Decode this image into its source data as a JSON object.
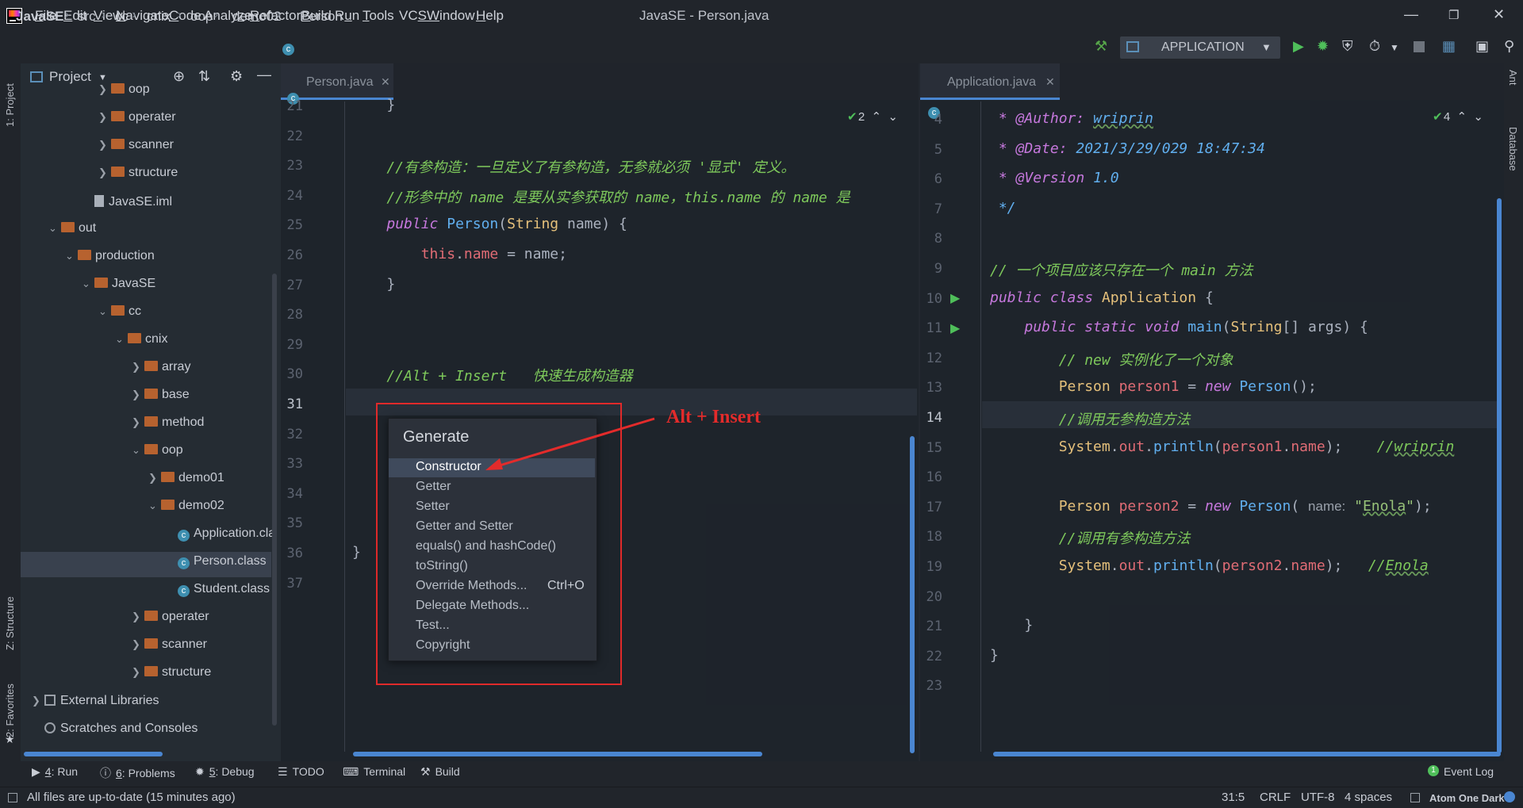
{
  "menubar": {
    "items": [
      "File",
      "Edit",
      "View",
      "Navigate",
      "Code",
      "Analyze",
      "Refactor",
      "Build",
      "Run",
      "Tools",
      "VCS",
      "Window",
      "Help"
    ],
    "mnemonics": [
      "F",
      "E",
      "V",
      "N",
      "C",
      "z",
      "R",
      "B",
      "u",
      "T",
      "S",
      "W",
      "H"
    ],
    "window_title": "JavaSE - Person.java"
  },
  "breadcrumb": [
    "JavaSE",
    "src",
    "cc",
    "cnix",
    "oop",
    "demo02",
    "Person"
  ],
  "toolbar": {
    "run_config": "APPLICATION"
  },
  "project": {
    "header": "Project",
    "rows": [
      {
        "label": "oop",
        "kind": "folder",
        "depth": 4,
        "chev": ">"
      },
      {
        "label": "operater",
        "kind": "folder",
        "depth": 4,
        "chev": ">"
      },
      {
        "label": "scanner",
        "kind": "folder",
        "depth": 4,
        "chev": ">"
      },
      {
        "label": "structure",
        "kind": "folder",
        "depth": 4,
        "chev": ">"
      },
      {
        "label": "JavaSE.iml",
        "kind": "file",
        "depth": 3,
        "chev": ""
      },
      {
        "label": "out",
        "kind": "folder",
        "depth": 1,
        "chev": "v"
      },
      {
        "label": "production",
        "kind": "folder",
        "depth": 2,
        "chev": "v"
      },
      {
        "label": "JavaSE",
        "kind": "folder",
        "depth": 3,
        "chev": "v"
      },
      {
        "label": "cc",
        "kind": "folder",
        "depth": 4,
        "chev": "v"
      },
      {
        "label": "cnix",
        "kind": "folder",
        "depth": 5,
        "chev": "v"
      },
      {
        "label": "array",
        "kind": "folder",
        "depth": 6,
        "chev": ">"
      },
      {
        "label": "base",
        "kind": "folder",
        "depth": 6,
        "chev": ">"
      },
      {
        "label": "method",
        "kind": "folder",
        "depth": 6,
        "chev": ">"
      },
      {
        "label": "oop",
        "kind": "folder",
        "depth": 6,
        "chev": "v"
      },
      {
        "label": "demo01",
        "kind": "folder",
        "depth": 7,
        "chev": ">"
      },
      {
        "label": "demo02",
        "kind": "folder",
        "depth": 7,
        "chev": "v"
      },
      {
        "label": "Application.cla",
        "kind": "class",
        "depth": 8,
        "chev": ""
      },
      {
        "label": "Person.class",
        "kind": "class",
        "depth": 8,
        "chev": ""
      },
      {
        "label": "Student.class",
        "kind": "class",
        "depth": 8,
        "chev": ""
      },
      {
        "label": "operater",
        "kind": "folder",
        "depth": 6,
        "chev": ">"
      },
      {
        "label": "scanner",
        "kind": "folder",
        "depth": 6,
        "chev": ">"
      },
      {
        "label": "structure",
        "kind": "folder",
        "depth": 6,
        "chev": ">"
      },
      {
        "label": "External Libraries",
        "kind": "lib",
        "depth": 0,
        "chev": ">"
      },
      {
        "label": "Scratches and Consoles",
        "kind": "scratch",
        "depth": 0,
        "chev": ""
      }
    ]
  },
  "left_tools": {
    "project": "1: Project",
    "structure": "Z: Structure",
    "favorites": "2: Favorites"
  },
  "right_tools": {
    "ant": "Ant",
    "database": "Database"
  },
  "editor_left": {
    "tab": "Person.java",
    "inspections": "2",
    "lines": [
      {
        "n": "21",
        "html": "    }"
      },
      {
        "n": "22",
        "html": ""
      },
      {
        "n": "23",
        "html": "    <span class='cm'>//有参构造：一旦定义了有参构造，无参就必须 '显式' 定义。</span>"
      },
      {
        "n": "24",
        "html": "    <span class='cm'>//形参中的 name 是要从实参获取的 name，this.name 的 name 是</span>"
      },
      {
        "n": "25",
        "html": "    <span class='kw'>public</span> <span class='fn'>Person</span>(<span class='ty'>String</span> name) {"
      },
      {
        "n": "26",
        "html": "        <span class='fld'>this</span>.<span class='fld'>name</span> = name;"
      },
      {
        "n": "27",
        "html": "    }"
      },
      {
        "n": "28",
        "html": ""
      },
      {
        "n": "29",
        "html": ""
      },
      {
        "n": "30",
        "html": "    <span class='cm'>//Alt + Insert   快速生成构造器</span>"
      },
      {
        "n": "31",
        "html": ""
      },
      {
        "n": "32",
        "html": ""
      },
      {
        "n": "33",
        "html": ""
      },
      {
        "n": "34",
        "html": ""
      },
      {
        "n": "35",
        "html": ""
      },
      {
        "n": "36",
        "html": "}"
      },
      {
        "n": "37",
        "html": ""
      }
    ]
  },
  "editor_right": {
    "tab": "Application.java",
    "inspections": "4",
    "lines": [
      {
        "n": "4",
        "html": " <span class='ann'>* @Author: </span><span class='fn' style='font-style:italic;text-decoration:underline wavy #6a9a5a'>wriprin</span>"
      },
      {
        "n": "5",
        "html": " <span class='ann'>* @Date: </span><span class='fn' style='font-style:italic'>2021/3/29/029 18:47:34</span>"
      },
      {
        "n": "6",
        "html": " <span class='ann'>* @Version </span><span class='fn' style='font-style:italic'>1.0</span>"
      },
      {
        "n": "7",
        "html": " <span class='fn' style='font-style:italic'>*/</span>"
      },
      {
        "n": "8",
        "html": ""
      },
      {
        "n": "9",
        "html": "<span class='cm'>// 一个项目应该只存在一个 main 方法</span>"
      },
      {
        "n": "10",
        "html": "<span class='kw'>public class</span> <span class='ty'>Application</span> {"
      },
      {
        "n": "11",
        "html": "    <span class='kw'>public static void</span> <span class='fn'>main</span>(<span class='ty'>String</span>[] args) {"
      },
      {
        "n": "12",
        "html": "        <span class='cm'>// new 实例化了一个对象</span>"
      },
      {
        "n": "13",
        "html": "        <span class='ty'>Person</span> <span class='fld'>person1</span> = <span class='kw'>new</span> <span class='fn'>Person</span>();"
      },
      {
        "n": "14",
        "html": "        <span class='cm'>//调用无参构造方法</span>"
      },
      {
        "n": "15",
        "html": "        <span class='ty'>System</span>.<span class='fld'>out</span>.<span class='fn'>println</span>(<span class='fld'>person1</span>.<span class='fld'>name</span>);    <span class='cm'>//<span style='text-decoration:underline wavy #6a9a5a'>wriprin</span></span>"
      },
      {
        "n": "16",
        "html": ""
      },
      {
        "n": "17",
        "html": "        <span class='ty'>Person</span> <span class='fld'>person2</span> = <span class='kw'>new</span> <span class='fn'>Person</span>( <span class='hint'>name:</span> <span class='str'>\"<span style='text-decoration:underline wavy #6a9a5a'>Enola</span>\"</span>);"
      },
      {
        "n": "18",
        "html": "        <span class='cm'>//调用有参构造方法</span>"
      },
      {
        "n": "19",
        "html": "        <span class='ty'>System</span>.<span class='fld'>out</span>.<span class='fn'>println</span>(<span class='fld'>person2</span>.<span class='fld'>name</span>);   <span class='cm'>//<span style='text-decoration:underline wavy #6a9a5a'>Enola</span></span>"
      },
      {
        "n": "20",
        "html": ""
      },
      {
        "n": "21",
        "html": "    }"
      },
      {
        "n": "22",
        "html": "}"
      },
      {
        "n": "23",
        "html": ""
      }
    ]
  },
  "generate_popup": {
    "title": "Generate",
    "items": [
      {
        "label": "Constructor",
        "shortcut": ""
      },
      {
        "label": "Getter",
        "shortcut": ""
      },
      {
        "label": "Setter",
        "shortcut": ""
      },
      {
        "label": "Getter and Setter",
        "shortcut": ""
      },
      {
        "label": "equals() and hashCode()",
        "shortcut": ""
      },
      {
        "label": "toString()",
        "shortcut": ""
      },
      {
        "label": "Override Methods...",
        "shortcut": "Ctrl+O"
      },
      {
        "label": "Delegate Methods...",
        "shortcut": ""
      },
      {
        "label": "Test...",
        "shortcut": ""
      },
      {
        "label": "Copyright",
        "shortcut": ""
      }
    ],
    "annotation": "Alt + Insert"
  },
  "bottom_tools": [
    {
      "num": "4",
      "label": "Run"
    },
    {
      "num": "6",
      "label": "Problems"
    },
    {
      "num": "5",
      "label": "Debug"
    },
    {
      "num": "",
      "label": "TODO"
    },
    {
      "num": "",
      "label": "Terminal"
    },
    {
      "num": "",
      "label": "Build"
    }
  ],
  "event_log": "Event Log",
  "status": {
    "message": "All files are up-to-date (15 minutes ago)",
    "position": "31:5",
    "line_sep": "CRLF",
    "encoding": "UTF-8",
    "indent": "4 spaces",
    "theme": "Atom One Dark"
  },
  "colors": {
    "accent": "#4a86d1",
    "annotation": "#e32b2b",
    "comment": "#7ec95b"
  }
}
